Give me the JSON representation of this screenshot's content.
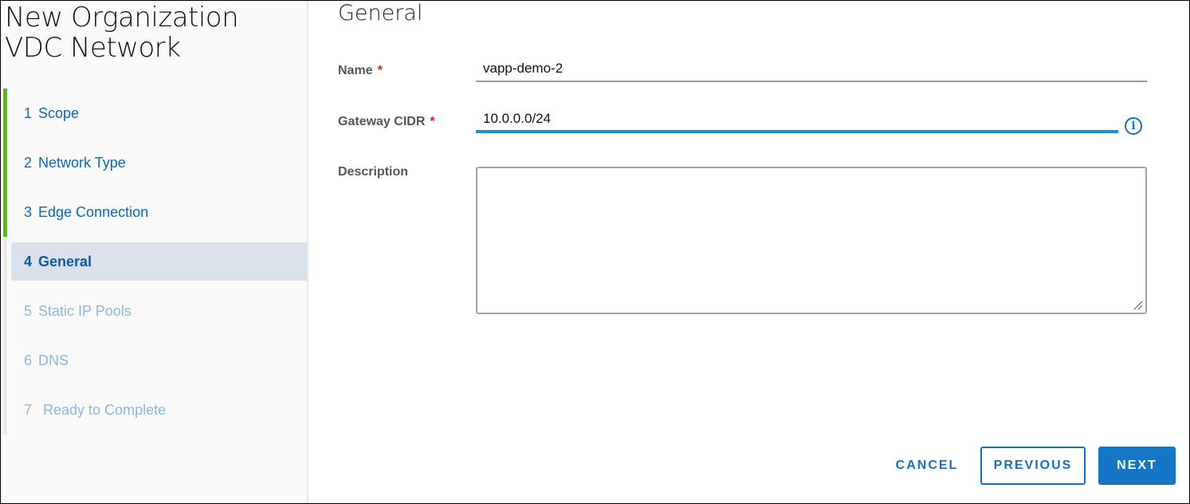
{
  "wizard": {
    "title_line1": "New Organization",
    "title_line2": "VDC Network"
  },
  "steps": [
    {
      "num": "1",
      "label": "Scope",
      "state": "completed"
    },
    {
      "num": "2",
      "label": "Network Type",
      "state": "completed"
    },
    {
      "num": "3",
      "label": "Edge Connection",
      "state": "completed"
    },
    {
      "num": "4",
      "label": "General",
      "state": "current"
    },
    {
      "num": "5",
      "label": "Static IP Pools",
      "state": "future"
    },
    {
      "num": "6",
      "label": "DNS",
      "state": "future"
    },
    {
      "num": "7",
      "label": "Ready to Complete",
      "state": "future"
    }
  ],
  "main": {
    "title": "General",
    "fields": {
      "name": {
        "label": "Name",
        "required_mark": "*",
        "value": "vapp-demo-2"
      },
      "gateway_cidr": {
        "label": "Gateway CIDR",
        "required_mark": "*",
        "value": "10.0.0.0/24",
        "info_icon": "i"
      },
      "description": {
        "label": "Description",
        "value": ""
      }
    }
  },
  "footer": {
    "cancel_label": "CANCEL",
    "previous_label": "PREVIOUS",
    "next_label": "NEXT"
  },
  "colors": {
    "accent": "#1676c6",
    "completed_step": "#62b02d",
    "required": "#e02020",
    "focus_underline": "#1a8fd4"
  }
}
